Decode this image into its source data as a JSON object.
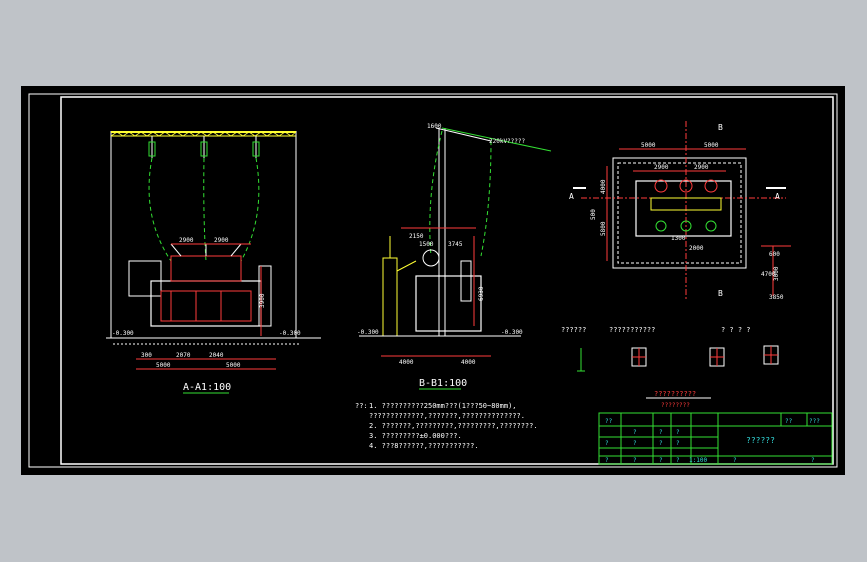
{
  "views": {
    "section_a": {
      "title": "A-A1:100",
      "dims_top": [
        "2900",
        "2900"
      ],
      "dims_bottom": [
        "5000",
        "5000"
      ],
      "dims_sub": [
        "300",
        "2070",
        "2040"
      ],
      "level_left": "-0.300",
      "level_right": "-0.300",
      "height_dim": "3900"
    },
    "section_b": {
      "title": "B-B1:100",
      "top_label": "1600",
      "line_label": "220kV?????",
      "dims_top": [
        "2150",
        "1500",
        "3745"
      ],
      "dims_bottom": [
        "4000",
        "4000"
      ],
      "level_left": "-0.300",
      "level_right": "-0.300",
      "height_dim": "6930"
    },
    "plan": {
      "dims_top": [
        "5000",
        "5000"
      ],
      "dims_inner": [
        "2900",
        "2900"
      ],
      "left_dims": [
        "4000",
        "5800",
        "500"
      ],
      "right_dims": [
        "600",
        "4700",
        "3000",
        "3850"
      ],
      "section_marks": [
        "A",
        "A",
        "B",
        "B"
      ],
      "center_dim": "1300",
      "bottom_dim": "2000"
    }
  },
  "details": {
    "label_1": "??????",
    "label_2": "???????????",
    "label_3": "? ? ? ?",
    "subtitle": "??????????",
    "scale": "????????"
  },
  "notes": {
    "prefix": "??:",
    "items": [
      "1. ??????????250mm???(1???50~80mm),",
      "   ?????????????,???????,??????????????.",
      "2. ???????,?????????,?????????,????????.",
      "3. ?????????±0.000???.",
      "4. ???8??????,???????????."
    ]
  },
  "title_block": {
    "main_title": "??????",
    "scale": "1:100",
    "cells": [
      "??",
      "???",
      "??",
      "?",
      "?",
      "?",
      "?",
      "?",
      "?",
      "?",
      "?",
      "?",
      "?",
      "?",
      "?",
      "?"
    ]
  },
  "colors": {
    "background": "#000000",
    "frame": "#ffffff",
    "green": "#33e033",
    "red": "#ff3b3b",
    "yellow": "#ffff33",
    "cyan": "#33dddd"
  }
}
